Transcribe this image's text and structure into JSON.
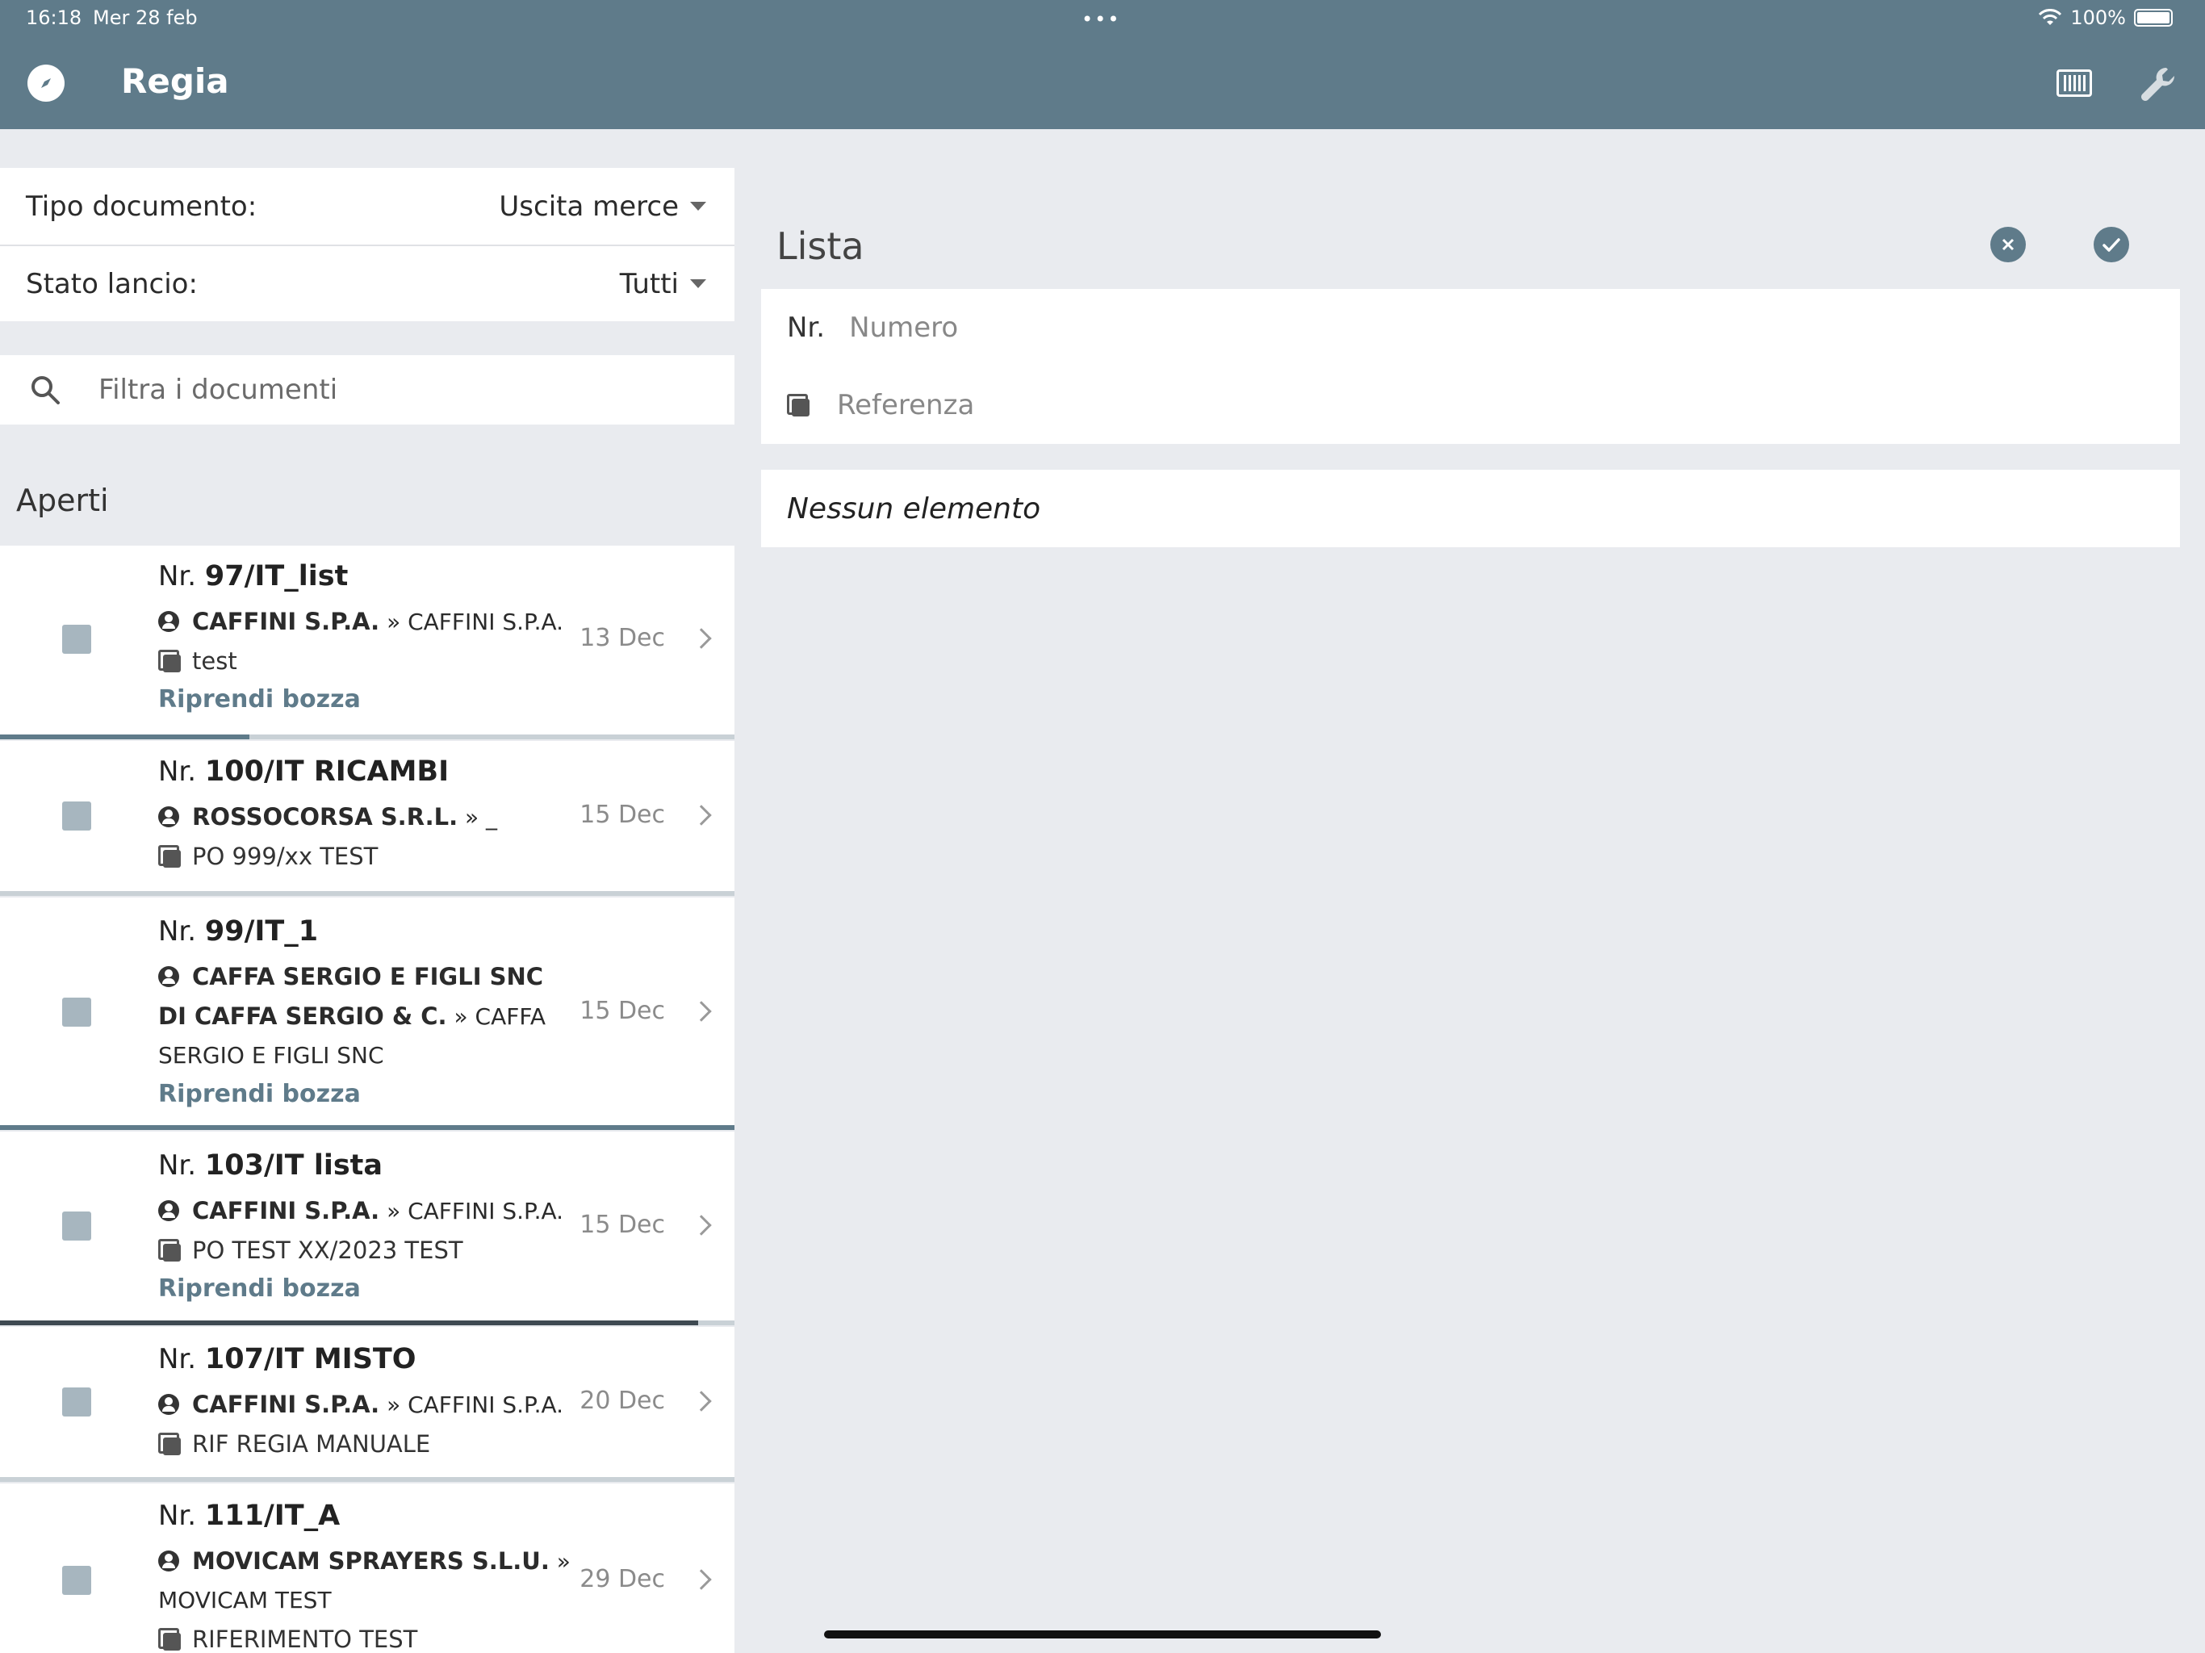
{
  "status_bar": {
    "time": "16:18",
    "date": "Mer 28 feb",
    "dots": "•••",
    "battery": "100%"
  },
  "header": {
    "title": "Regia"
  },
  "filters": {
    "tipo_label": "Tipo documento:",
    "tipo_value": "Uscita merce",
    "stato_label": "Stato lancio:",
    "stato_value": "Tutti"
  },
  "search": {
    "placeholder": "Filtra i documenti"
  },
  "section_title": "Aperti",
  "documents": [
    {
      "nr_prefix": "Nr.",
      "nr": "97/IT_list",
      "customer": "CAFFINI S.P.A.",
      "dest": "» CAFFINI S.P.A.",
      "ref": "test",
      "date": "13 Dec",
      "resume": "Riprendi bozza",
      "progress": 0.34
    },
    {
      "nr_prefix": "Nr.",
      "nr": "100/IT RICAMBI",
      "customer": "ROSSOCORSA S.R.L.",
      "dest": "» _",
      "ref": "PO 999/xx TEST",
      "date": "15 Dec",
      "resume": "",
      "progress": 0
    },
    {
      "nr_prefix": "Nr.",
      "nr": "99/IT_1",
      "customer": "CAFFA SERGIO E FIGLI SNC DI CAFFA SERGIO & C.",
      "dest": "» CAFFA SERGIO E FIGLI SNC",
      "ref": "",
      "date": "15 Dec",
      "resume": "Riprendi bozza",
      "progress": 1.0
    },
    {
      "nr_prefix": "Nr.",
      "nr": "103/IT lista",
      "customer": "CAFFINI S.P.A.",
      "dest": "» CAFFINI S.P.A.",
      "ref": "PO TEST XX/2023 TEST",
      "date": "15 Dec",
      "resume": "Riprendi bozza",
      "progress": 0.95
    },
    {
      "nr_prefix": "Nr.",
      "nr": "107/IT MISTO",
      "customer": "CAFFINI S.P.A.",
      "dest": "» CAFFINI S.P.A.",
      "ref": "RIF REGIA MANUALE",
      "date": "20 Dec",
      "resume": "",
      "progress": 0
    },
    {
      "nr_prefix": "Nr.",
      "nr": "111/IT_A",
      "customer": "MOVICAM SPRAYERS S.L.U.",
      "dest": "» MOVICAM TEST",
      "ref": "RIFERIMENTO TEST",
      "date": "29 Dec",
      "resume": "",
      "progress": 0
    }
  ],
  "lista": {
    "title": "Lista",
    "nr_label": "Nr.",
    "nr_placeholder": "Numero",
    "ref_placeholder": "Referenza",
    "empty": "Nessun elemento"
  },
  "colors": {
    "header": "#5f7b8a",
    "accent": "#5f7b8a",
    "background": "#e9ebef"
  }
}
